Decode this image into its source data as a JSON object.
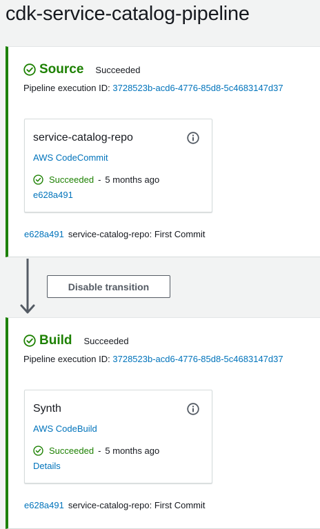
{
  "page": {
    "title": "cdk-service-catalog-pipeline"
  },
  "colors": {
    "success": "#1d8102",
    "link": "#0073bb",
    "text": "#16191f",
    "button_border": "#545b64"
  },
  "stages": [
    {
      "name": "Source",
      "status": "Succeeded",
      "execution_label": "Pipeline execution ID:",
      "execution_id": "3728523b-acd6-4776-85d8-5c4683147d37",
      "action": {
        "name": "service-catalog-repo",
        "provider": "AWS CodeCommit",
        "status": "Succeeded",
        "separator": "-",
        "time": "5 months ago",
        "link": "e628a491",
        "info_icon": "info-icon"
      },
      "commit": {
        "id": "e628a491",
        "message": "service-catalog-repo: First Commit"
      }
    },
    {
      "name": "Build",
      "status": "Succeeded",
      "execution_label": "Pipeline execution ID:",
      "execution_id": "3728523b-acd6-4776-85d8-5c4683147d37",
      "action": {
        "name": "Synth",
        "provider": "AWS CodeBuild",
        "status": "Succeeded",
        "separator": "-",
        "time": "5 months ago",
        "link": "Details",
        "info_icon": "info-icon"
      },
      "commit": {
        "id": "e628a491",
        "message": "service-catalog-repo: First Commit"
      }
    }
  ],
  "transition": {
    "button_label": "Disable transition",
    "arrow_icon": "arrow-down-icon"
  }
}
